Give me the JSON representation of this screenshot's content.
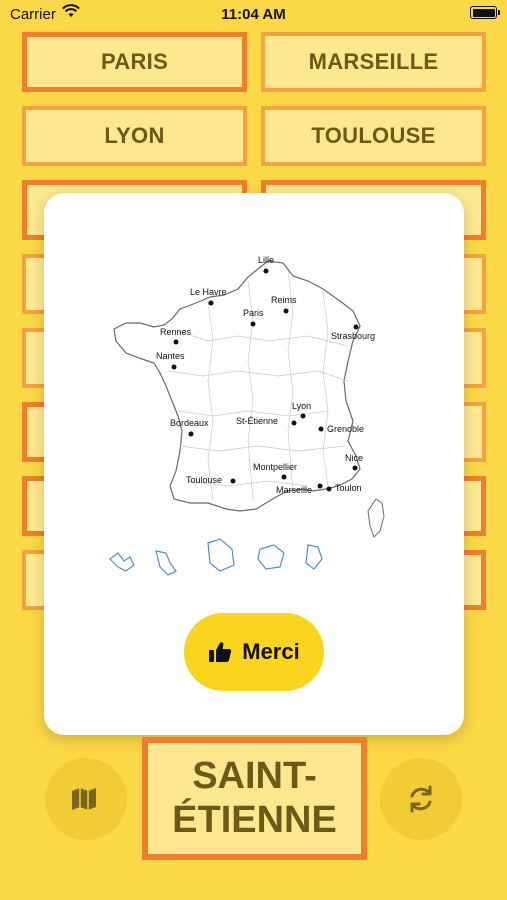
{
  "status_bar": {
    "carrier": "Carrier",
    "time": "11:04 AM"
  },
  "choices": [
    {
      "label": "PARIS"
    },
    {
      "label": "MARSEILLE"
    },
    {
      "label": "LYON"
    },
    {
      "label": "TOULOUSE"
    }
  ],
  "map_labels": [
    "Lille",
    "Le Havre",
    "Reims",
    "Paris",
    "Strasbourg",
    "Rennes",
    "Nantes",
    "Lyon",
    "Bordeaux",
    "St-Étienne",
    "Grenoble",
    "Nice",
    "Montpellier",
    "Toulouse",
    "Marseille",
    "Toulon"
  ],
  "merci_button": {
    "label": "Merci",
    "icon": "thumbs-up-icon"
  },
  "target_word": {
    "line1": "SAINT-",
    "line2": "ÉTIENNE"
  },
  "left_button": {
    "icon": "map-icon"
  },
  "right_button": {
    "icon": "refresh-icon"
  },
  "colors": {
    "background": "#fbd845",
    "button_fill": "#fde88f",
    "border": "#f6a13f",
    "selected_border": "#f27d2c",
    "text": "#6b5a18",
    "merci": "#fbd41d"
  }
}
